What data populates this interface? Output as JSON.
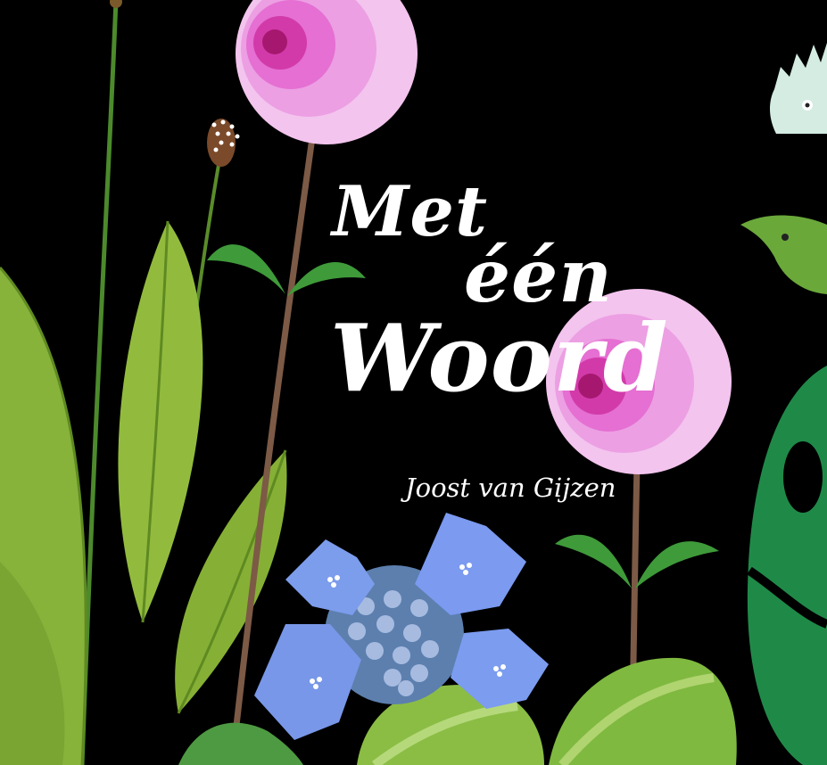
{
  "cover": {
    "title_line1": "Met",
    "title_line2": "één",
    "title_line3": "Woord",
    "author": "Joost van Gijzen"
  },
  "colors": {
    "background": "#000000",
    "text": "#ffffff",
    "leaf_green": "#8db63a",
    "dark_green": "#1f8a48",
    "pink_flower": "#f0a6e6",
    "blue_flower": "#6f93e6",
    "stem_brown": "#7c5a46"
  }
}
